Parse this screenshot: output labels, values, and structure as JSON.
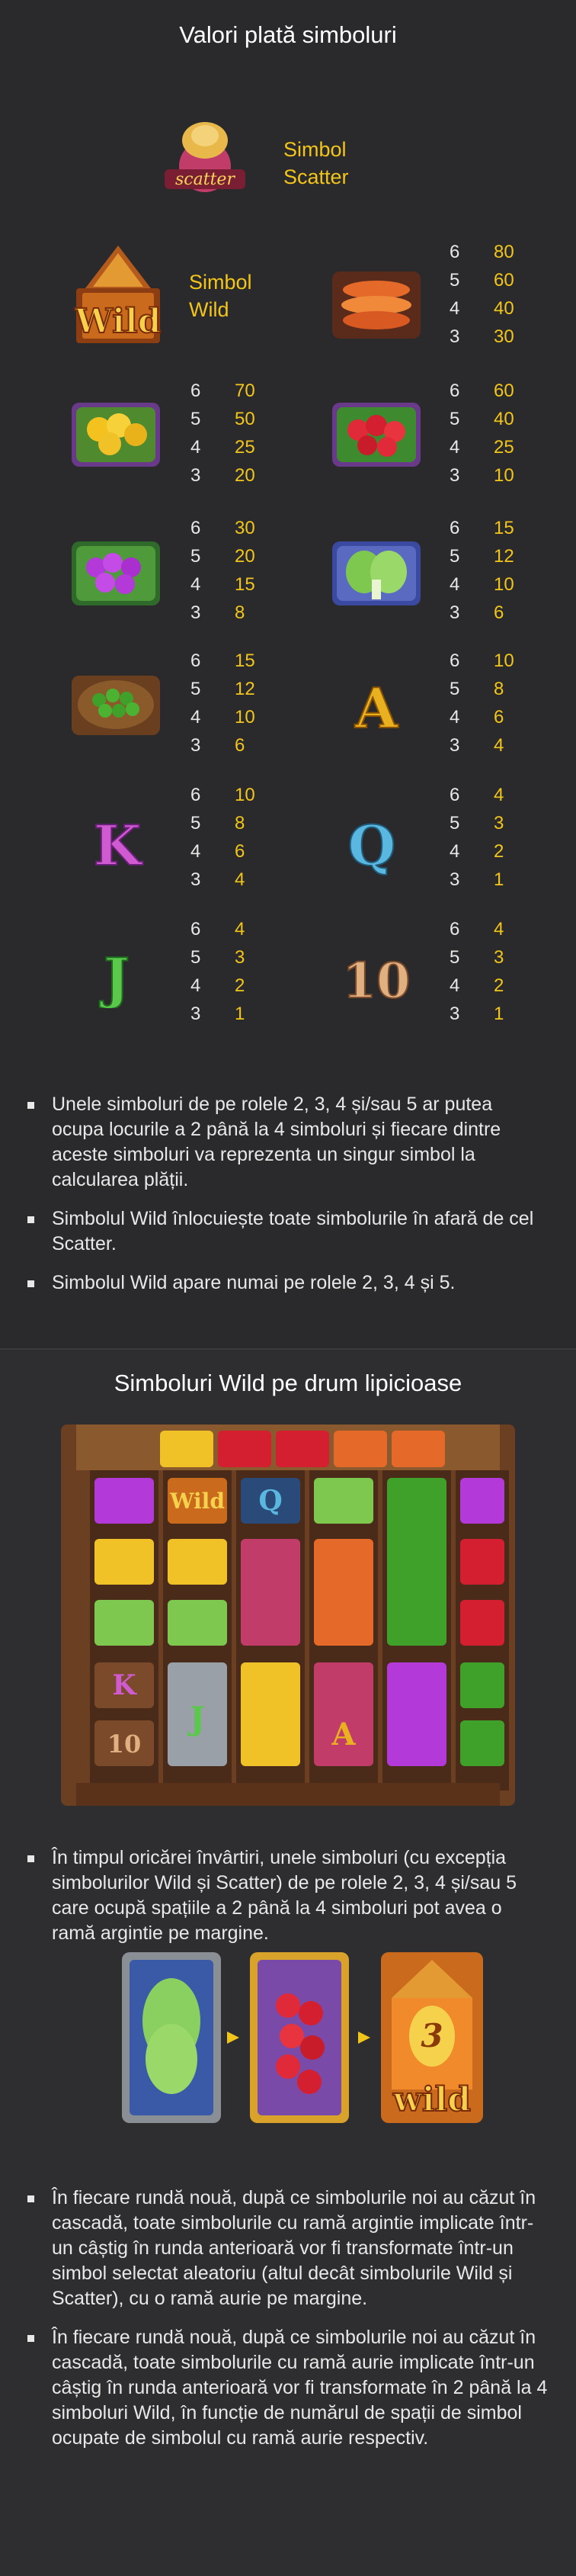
{
  "section1_title": "Valori plată simboluri",
  "scatter": {
    "label": "Simbol\nScatter",
    "text": "scatter"
  },
  "wild": {
    "label": "Simbol\nWild",
    "text": "Wild"
  },
  "paytable": [
    {
      "symbol": "fish",
      "counts": [
        "6",
        "5",
        "4",
        "3"
      ],
      "values": [
        "80",
        "60",
        "40",
        "30"
      ]
    },
    {
      "symbol": "mango",
      "counts": [
        "6",
        "5",
        "4",
        "3"
      ],
      "values": [
        "70",
        "50",
        "25",
        "20"
      ]
    },
    {
      "symbol": "rambutan",
      "counts": [
        "6",
        "5",
        "4",
        "3"
      ],
      "values": [
        "60",
        "40",
        "25",
        "10"
      ]
    },
    {
      "symbol": "orchid",
      "counts": [
        "6",
        "5",
        "4",
        "3"
      ],
      "values": [
        "30",
        "20",
        "15",
        "8"
      ]
    },
    {
      "symbol": "cabbage",
      "counts": [
        "6",
        "5",
        "4",
        "3"
      ],
      "values": [
        "15",
        "12",
        "10",
        "6"
      ]
    },
    {
      "symbol": "peas",
      "counts": [
        "6",
        "5",
        "4",
        "3"
      ],
      "values": [
        "15",
        "12",
        "10",
        "6"
      ]
    },
    {
      "symbol": "A",
      "counts": [
        "6",
        "5",
        "4",
        "3"
      ],
      "values": [
        "10",
        "8",
        "6",
        "4"
      ]
    },
    {
      "symbol": "K",
      "counts": [
        "6",
        "5",
        "4",
        "3"
      ],
      "values": [
        "10",
        "8",
        "6",
        "4"
      ]
    },
    {
      "symbol": "Q",
      "counts": [
        "6",
        "5",
        "4",
        "3"
      ],
      "values": [
        "4",
        "3",
        "2",
        "1"
      ]
    },
    {
      "symbol": "J",
      "counts": [
        "6",
        "5",
        "4",
        "3"
      ],
      "values": [
        "4",
        "3",
        "2",
        "1"
      ]
    },
    {
      "symbol": "10",
      "counts": [
        "6",
        "5",
        "4",
        "3"
      ],
      "values": [
        "4",
        "3",
        "2",
        "1"
      ]
    }
  ],
  "notes1": [
    "Unele simboluri de pe rolele 2, 3, 4 și/sau 5 ar putea ocupa locurile a 2 până la 4 simboluri și fiecare dintre aceste simboluri va reprezenta un singur simbol la calcularea plății.",
    "Simbolul Wild înlocuiește toate simbolurile în afară de cel Scatter.",
    "Simbolul Wild apare numai pe rolele 2, 3, 4 și 5."
  ],
  "section2_title": "Simboluri Wild pe drum lipicioase",
  "notes2": [
    "În timpul oricărei învârtiri, unele simboluri (cu excepția simbolurilor Wild și Scatter) de pe rolele 2, 3, 4 și/sau 5 care ocupă spațiile a 2 până la 4 simboluri pot avea o ramă argintie pe margine."
  ],
  "transform": {
    "count": "3",
    "wild_text": "wild"
  },
  "notes3": [
    "În fiecare rundă nouă, după ce simbolurile noi au căzut în cascadă, toate simbolurile cu ramă argintie implicate într-un câștig în runda anterioară vor fi transformate într-un simbol selectat aleatoriu (altul decât simbolurile Wild și Scatter), cu o ramă aurie pe margine.",
    "În fiecare rundă nouă, după ce simbolurile noi au căzut în cascadă, toate simbolurile cu ramă aurie implicate într-un câștig în runda anterioară vor fi transformate în 2 până la 4 simboluri Wild, în funcție de numărul de spații de simbol ocupate de simbolul cu ramă aurie respectiv."
  ],
  "colors": {
    "accent": "#f2c51a",
    "bg": "#2a2a2d",
    "text": "#e8e8e8"
  }
}
